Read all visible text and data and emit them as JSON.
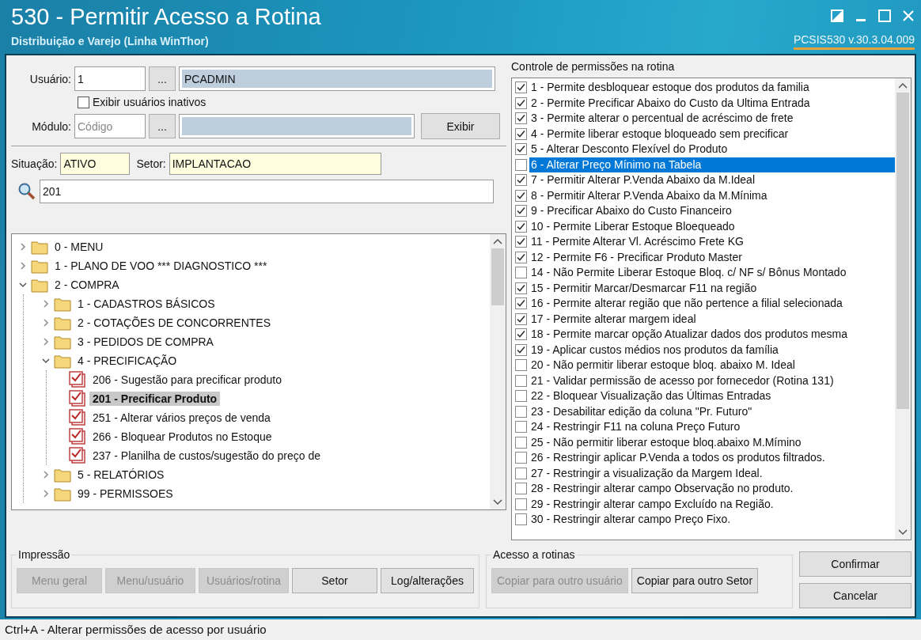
{
  "window": {
    "title": "530 - Permitir Acesso a Rotina",
    "subtitle": "Distribuição e Varejo (Linha WinThor)",
    "version": "PCSIS530  v.30.3.04.009"
  },
  "user": {
    "label": "Usuário:",
    "code": "1",
    "lookup": "...",
    "name": "PCADMIN"
  },
  "show_inactive": {
    "label": "Exibir usuários inativos",
    "checked": false
  },
  "module": {
    "label": "Módulo:",
    "placeholder": "Código",
    "lookup": "...",
    "button": "Exibir"
  },
  "situation": {
    "label": "Situação:",
    "value": "ATIVO"
  },
  "sector": {
    "label": "Setor:",
    "value": "IMPLANTACAO"
  },
  "search": {
    "value": "201"
  },
  "tree": [
    {
      "kind": "folder",
      "label": "0 - MENU",
      "expanded": false,
      "selected": false
    },
    {
      "kind": "folder",
      "label": "1 - PLANO DE VOO   *** DIAGNOSTICO ***",
      "expanded": false,
      "selected": false
    },
    {
      "kind": "folder",
      "label": "2 - COMPRA",
      "expanded": true,
      "selected": false,
      "children": [
        {
          "kind": "folder",
          "label": "1 - CADASTROS BÁSICOS",
          "expanded": false,
          "selected": false
        },
        {
          "kind": "folder",
          "label": "2 - COTAÇÕES DE CONCORRENTES",
          "expanded": false,
          "selected": false
        },
        {
          "kind": "folder",
          "label": "3 - PEDIDOS DE COMPRA",
          "expanded": false,
          "selected": false
        },
        {
          "kind": "folder",
          "label": "4 - PRECIFICAÇÃO",
          "expanded": true,
          "selected": false,
          "children": [
            {
              "kind": "routine",
              "label": "206 - Sugestão para precificar produto",
              "checked": true,
              "selected": false
            },
            {
              "kind": "routine",
              "label": "201 - Precificar Produto",
              "checked": true,
              "selected": true
            },
            {
              "kind": "routine",
              "label": "251 - Alterar vários preços de venda",
              "checked": true,
              "selected": false
            },
            {
              "kind": "routine",
              "label": "266 - Bloquear Produtos no Estoque",
              "checked": true,
              "selected": false
            },
            {
              "kind": "routine",
              "label": "237 - Planilha de custos/sugestão do preço de",
              "checked": true,
              "selected": false
            }
          ]
        },
        {
          "kind": "folder",
          "label": "5 - RELATÓRIOS",
          "expanded": false,
          "selected": false
        },
        {
          "kind": "folder",
          "label": "99 - PERMISSOES",
          "expanded": false,
          "selected": false
        }
      ]
    }
  ],
  "permissions": {
    "title": "Controle de permissões na rotina",
    "items": [
      {
        "label": "1 - Permite desbloquear estoque dos produtos da familia",
        "checked": true,
        "selected": false
      },
      {
        "label": "2 - Permite Precificar Abaixo do Custo da Ultima Entrada",
        "checked": true,
        "selected": false
      },
      {
        "label": "3 - Permite alterar o percentual de acréscimo de frete",
        "checked": true,
        "selected": false
      },
      {
        "label": "4 - Permite liberar estoque bloqueado sem precificar",
        "checked": true,
        "selected": false
      },
      {
        "label": "5 - Alterar Desconto Flexível do Produto",
        "checked": true,
        "selected": false
      },
      {
        "label": "6 - Alterar Preço Mínimo na Tabela",
        "checked": false,
        "selected": true
      },
      {
        "label": "7 - Permitir Alterar P.Venda Abaixo da M.Ideal",
        "checked": true,
        "selected": false
      },
      {
        "label": "8 - Permitir Alterar P.Venda Abaixo da M.Mínima",
        "checked": true,
        "selected": false
      },
      {
        "label": "9 - Precificar Abaixo do Custo Financeiro",
        "checked": true,
        "selected": false
      },
      {
        "label": "10 - Permite Liberar Estoque Bloequeado",
        "checked": true,
        "selected": false
      },
      {
        "label": "11 - Permite Alterar Vl. Acréscimo Frete KG",
        "checked": true,
        "selected": false
      },
      {
        "label": "12 - Permite F6 - Precificar Produto Master",
        "checked": true,
        "selected": false
      },
      {
        "label": "14 - Não Permite Liberar Estoque Bloq. c/ NF s/ Bônus Montado",
        "checked": false,
        "selected": false
      },
      {
        "label": "15 - Permitir Marcar/Desmarcar F11 na região",
        "checked": true,
        "selected": false
      },
      {
        "label": "16 - Permite alterar região que não pertence a filial selecionada",
        "checked": true,
        "selected": false
      },
      {
        "label": "17 - Permite alterar margem ideal",
        "checked": true,
        "selected": false
      },
      {
        "label": "18 - Permite marcar opção Atualizar dados dos produtos mesma",
        "checked": true,
        "selected": false
      },
      {
        "label": "19 - Aplicar custos médios nos produtos da família",
        "checked": true,
        "selected": false
      },
      {
        "label": "20 - Não permitir liberar estoque bloq. abaixo M. Ideal",
        "checked": false,
        "selected": false
      },
      {
        "label": "21 - Validar permissão de acesso por fornecedor (Rotina 131)",
        "checked": false,
        "selected": false
      },
      {
        "label": "22 - Bloquear Visualização das Últimas Entradas",
        "checked": false,
        "selected": false
      },
      {
        "label": "23 - Desabilitar edição da coluna \"Pr. Futuro\"",
        "checked": false,
        "selected": false
      },
      {
        "label": "24 - Restringir F11 na coluna Preço Futuro",
        "checked": false,
        "selected": false
      },
      {
        "label": "25 - Não permitir liberar estoque bloq.abaixo M.Mímino",
        "checked": false,
        "selected": false
      },
      {
        "label": "26 - Restringir aplicar P.Venda a todos os produtos filtrados.",
        "checked": false,
        "selected": false
      },
      {
        "label": "27 - Restringir a visualização da Margem Ideal.",
        "checked": false,
        "selected": false
      },
      {
        "label": "28 - Restringir alterar campo Observação no produto.",
        "checked": false,
        "selected": false
      },
      {
        "label": "29 - Restringir alterar campo Excluído na Região.",
        "checked": false,
        "selected": false
      },
      {
        "label": "30 - Restringir alterar campo Preço Fixo.",
        "checked": false,
        "selected": false
      }
    ]
  },
  "printing": {
    "title": "Impressão",
    "buttons": [
      {
        "label": "Menu geral",
        "disabled": true
      },
      {
        "label": "Menu/usuário",
        "disabled": true
      },
      {
        "label": "Usuários/rotina",
        "disabled": true
      },
      {
        "label": "Setor",
        "disabled": false
      },
      {
        "label": "Log/alterações",
        "disabled": false
      }
    ]
  },
  "access": {
    "title": "Acesso a rotinas",
    "buttons": [
      {
        "label": "Copiar para outro usuário",
        "disabled": true
      },
      {
        "label": "Copiar para outro Setor",
        "disabled": false
      }
    ]
  },
  "actions": [
    "Confirmar",
    "Cancelar"
  ],
  "status_bar": "Ctrl+A - Alterar permissões de acesso por usuário"
}
